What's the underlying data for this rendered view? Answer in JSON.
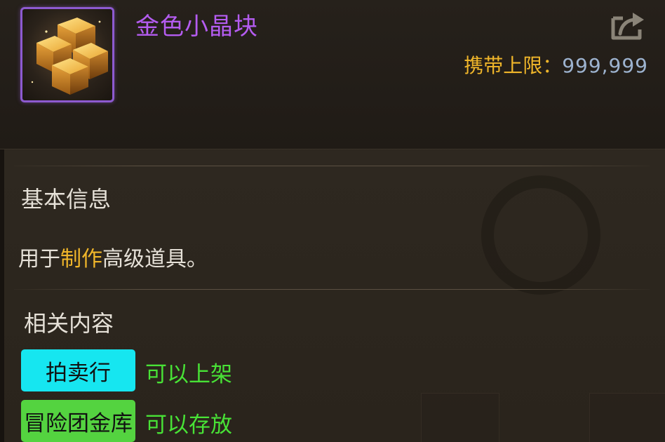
{
  "item": {
    "name": "金色小晶块",
    "icon": "gold-crystal-cubes-icon",
    "rarity_color": "#b45cf0"
  },
  "header": {
    "share_icon": "share-export-icon",
    "carry_limit_label": "携带上限：",
    "carry_limit_value": "999,999"
  },
  "basic_info": {
    "title": "基本信息",
    "description_prefix": "用于",
    "description_highlight": "制作",
    "description_suffix": "高级道具。"
  },
  "related": {
    "title": "相关内容",
    "tags": [
      {
        "label": "拍卖行",
        "status": "可以上架",
        "color": "#16e6f0"
      },
      {
        "label": "冒险团金库",
        "status": "可以存放",
        "color": "#54d340"
      }
    ]
  },
  "colors": {
    "highlight": "#f0b62a",
    "status_green": "#48e236",
    "value_blue": "#9db3cf"
  }
}
